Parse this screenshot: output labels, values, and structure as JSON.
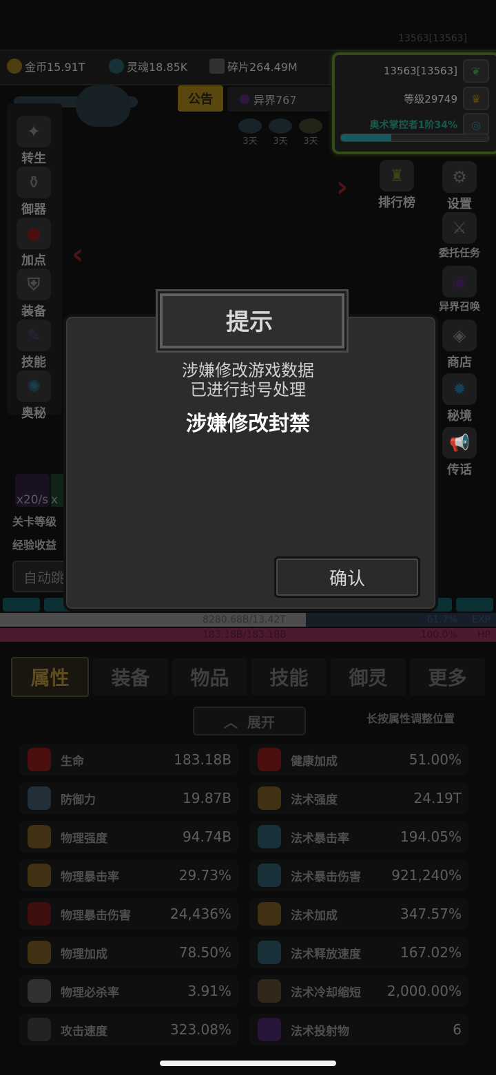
{
  "top_id": "13563[13563]",
  "resources": {
    "gold": "金币15.91T",
    "soul": "灵魂18.85K",
    "shard": "碎片264.49M"
  },
  "level_panel": {
    "id": "13563[13563]",
    "level": "等级29749",
    "title": "奥术掌控者1阶34%",
    "title_progress": 0.34
  },
  "banner": {
    "notice": "公告",
    "otherworld": "异界767",
    "buff_days": [
      "3天",
      "3天",
      "3天"
    ]
  },
  "left_menu": [
    "转生",
    "御器",
    "加点",
    "装备",
    "技能",
    "奥秘"
  ],
  "right_menu_top": {
    "ranking": "排行榜",
    "settings": "设置"
  },
  "right_menu": [
    "委托任务",
    "异界召唤",
    "商店",
    "秘境",
    "传话"
  ],
  "left_info": {
    "rate1": "x20/s",
    "rate2": "x",
    "stage_level": "关卡等级",
    "exp_income": "经验收益",
    "auto_button": "自动跳"
  },
  "exp_bar": {
    "value": "8280.68B/13.42T",
    "percent": "61.7%",
    "label": "EXP",
    "fill": 0.617
  },
  "hp_bar": {
    "value": "183.18B/183.18B",
    "percent": "100.0%",
    "label": "HP",
    "fill": 1.0
  },
  "tabs": [
    "属性",
    "装备",
    "物品",
    "技能",
    "御灵",
    "更多"
  ],
  "expand_label": "展开",
  "hint": "长按属性调整位置",
  "stats": [
    {
      "name": "生命",
      "value": "183.18B",
      "icon": "heart-icon",
      "color": "#5a1212"
    },
    {
      "name": "健康加成",
      "value": "51.00%",
      "icon": "heart-plus-icon",
      "color": "#5a1212"
    },
    {
      "name": "防御力",
      "value": "19.87B",
      "icon": "shield-icon",
      "color": "#2a3844"
    },
    {
      "name": "法术强度",
      "value": "24.19T",
      "icon": "horn-icon",
      "color": "#4a3a14"
    },
    {
      "name": "物理强度",
      "value": "94.74B",
      "icon": "sword-icon",
      "color": "#4a3a14"
    },
    {
      "name": "法术暴击率",
      "value": "194.05%",
      "icon": "dragon-icon",
      "color": "#1d3a44"
    },
    {
      "name": "物理暴击率",
      "value": "29.73%",
      "icon": "crit-icon",
      "color": "#4a3a14"
    },
    {
      "name": "法术暴击伤害",
      "value": "921,240%",
      "icon": "serpent-icon",
      "color": "#1d3a44"
    },
    {
      "name": "物理暴击伤害",
      "value": "24,436%",
      "icon": "blade-icon",
      "color": "#4a1212"
    },
    {
      "name": "法术加成",
      "value": "347.57%",
      "icon": "horn-plus-icon",
      "color": "#4a3a14"
    },
    {
      "name": "物理加成",
      "value": "78.50%",
      "icon": "axe-icon",
      "color": "#4a3a14"
    },
    {
      "name": "法术释放速度",
      "value": "167.02%",
      "icon": "cast-icon",
      "color": "#1d3a44"
    },
    {
      "name": "物理必杀率",
      "value": "3.91%",
      "icon": "skull-icon",
      "color": "#3a3a3a"
    },
    {
      "name": "法术冷却缩短",
      "value": "2,000.00%",
      "icon": "hourglass-icon",
      "color": "#3a3020"
    },
    {
      "name": "攻击速度",
      "value": "323.08%",
      "icon": "speed-sword-icon",
      "color": "#2a2a2a"
    },
    {
      "name": "法术投射物",
      "value": "6",
      "icon": "projectile-icon",
      "color": "#2e1a44"
    }
  ],
  "modal": {
    "title": "提示",
    "message_line1": "涉嫌修改游戏数据",
    "message_line2": "已进行封号处理",
    "ban_reason": "涉嫌修改封禁",
    "confirm": "确认"
  }
}
